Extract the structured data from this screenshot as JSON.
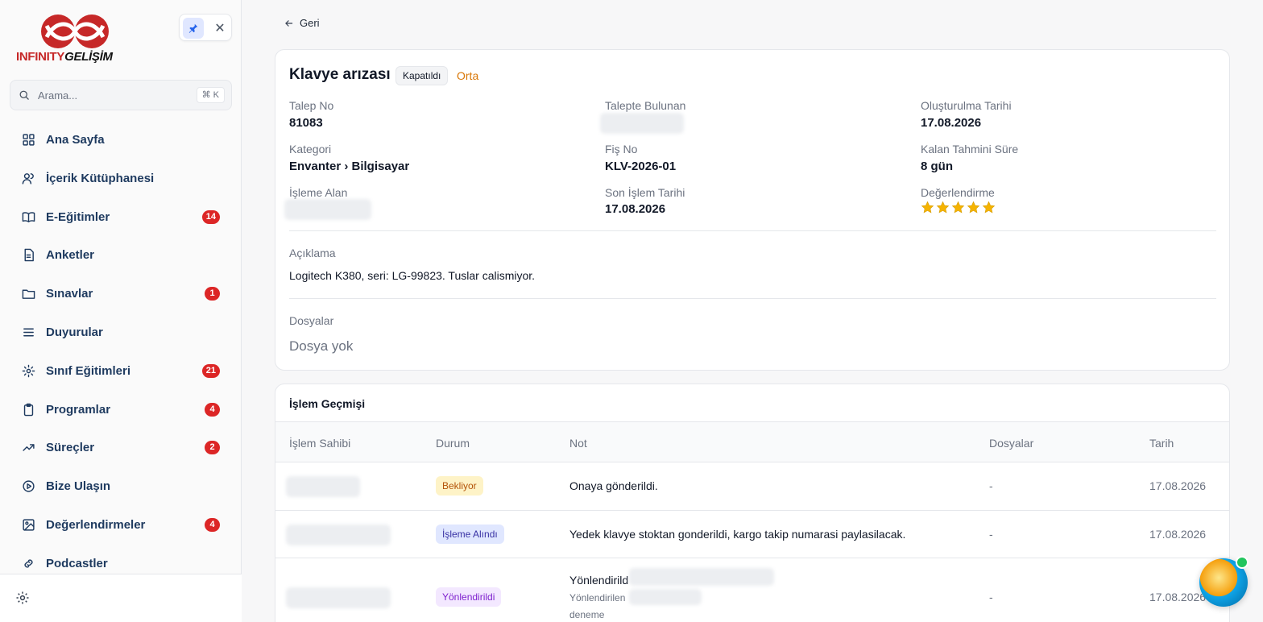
{
  "brand": {
    "part1": "INFINITY",
    "part2": "GELİŞİM"
  },
  "search": {
    "placeholder": "Arama...",
    "shortcut": "⌘ K"
  },
  "nav": [
    {
      "label": "Ana Sayfa",
      "icon": "grid-icon",
      "badge": ""
    },
    {
      "label": "İçerik Kütüphanesi",
      "icon": "users-icon",
      "badge": ""
    },
    {
      "label": "E-Eğitimler",
      "icon": "book-icon",
      "badge": "14"
    },
    {
      "label": "Anketler",
      "icon": "document-icon",
      "badge": ""
    },
    {
      "label": "Sınavlar",
      "icon": "folder-icon",
      "badge": "1"
    },
    {
      "label": "Duyurular",
      "icon": "list-icon",
      "badge": ""
    },
    {
      "label": "Sınıf Eğitimleri",
      "icon": "gear-icon",
      "badge": "21"
    },
    {
      "label": "Programlar",
      "icon": "clipboard-icon",
      "badge": "4"
    },
    {
      "label": "Süreçler",
      "icon": "trend-icon",
      "badge": "2"
    },
    {
      "label": "Bize Ulaşın",
      "icon": "play-circle-icon",
      "badge": ""
    },
    {
      "label": "Değerlendirmeler",
      "icon": "image-icon",
      "badge": "4"
    },
    {
      "label": "Podcastler",
      "icon": "link-icon",
      "badge": ""
    }
  ],
  "back_label": "Geri",
  "ticket": {
    "title": "Klavye arızası",
    "status": "Kapatıldı",
    "priority": "Orta",
    "fields": {
      "request_no_label": "Talep No",
      "request_no": "81083",
      "requester_label": "Talepte Bulunan",
      "created_label": "Oluşturulma Tarihi",
      "created": "17.08.2026",
      "category_label": "Kategori",
      "category": "Envanter › Bilgisayar",
      "receipt_label": "Fiş No",
      "receipt": "KLV-2026-01",
      "remaining_label": "Kalan Tahmini Süre",
      "remaining": "8 gün",
      "handler_label": "İşleme Alan",
      "last_action_label": "Son İşlem Tarihi",
      "last_action": "17.08.2026",
      "rating_label": "Değerlendirme",
      "rating": 5
    },
    "description_label": "Açıklama",
    "description": "Logitech K380, seri: LG-99823. Tuslar calismiyor.",
    "files_label": "Dosyalar",
    "files_empty": "Dosya yok"
  },
  "history": {
    "title": "İşlem Geçmişi",
    "columns": [
      "İşlem Sahibi",
      "Durum",
      "Not",
      "Dosyalar",
      "Tarih"
    ],
    "rows": [
      {
        "status": "Bekliyor",
        "note": "Onaya gönderildi.",
        "files": "-",
        "date": "17.08.2026"
      },
      {
        "status": "İşleme Alındı",
        "note": "Yedek klavye stoktan gonderildi, kargo takip numarasi paylasilacak.",
        "files": "-",
        "date": "17.08.2026"
      },
      {
        "status": "Yönlendirildi",
        "note": "Yönlendirild",
        "note_sub1": "Yönlendirilen",
        "note_sub2": "deneme",
        "files": "-",
        "date": "17.08.2026"
      }
    ]
  },
  "colors": {
    "accent": "#1e3a5f",
    "badge": "#dc2626",
    "priority": "#d97706",
    "star": "#f5b301"
  }
}
